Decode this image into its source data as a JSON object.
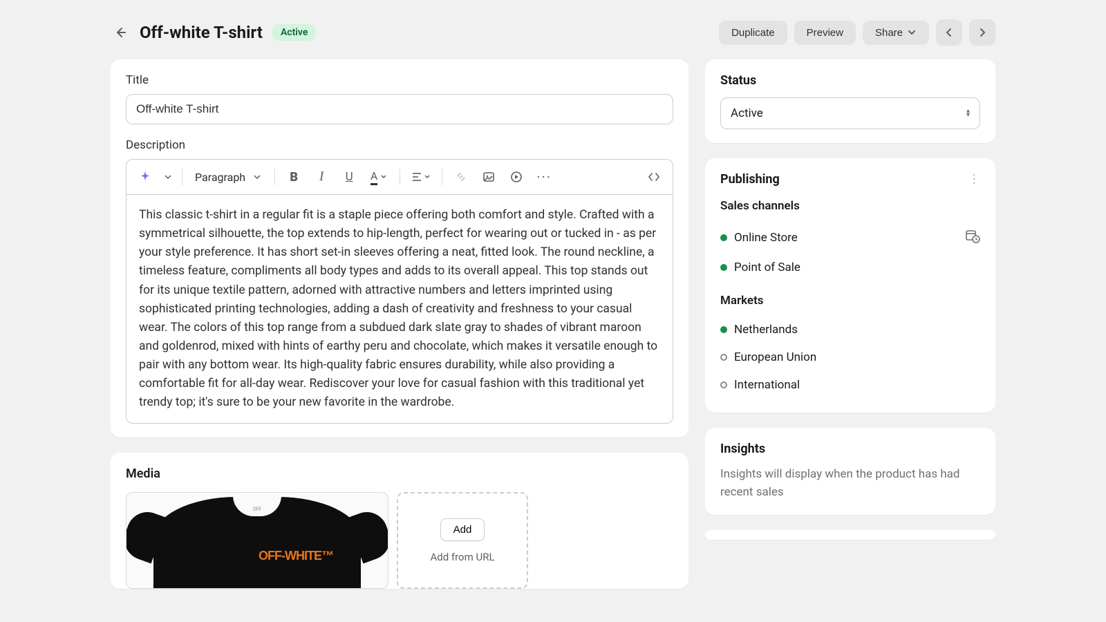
{
  "header": {
    "title": "Off-white T-shirt",
    "badge": "Active",
    "duplicate": "Duplicate",
    "preview": "Preview",
    "share": "Share"
  },
  "titleCard": {
    "label": "Title",
    "value": "Off-white T-shirt"
  },
  "descriptionCard": {
    "label": "Description",
    "paragraph": "Paragraph",
    "body": "This classic t-shirt in a regular fit is a staple piece offering both comfort and style. Crafted with a symmetrical silhouette, the top extends to hip-length, perfect for wearing out or tucked in - as per your style preference. It has short set-in sleeves offering a neat, fitted look. The round neckline, a timeless feature, compliments all body types and adds to its overall appeal. This top stands out for its unique textile pattern, adorned with attractive numbers and letters imprinted using sophisticated printing technologies, adding a dash of creativity and freshness to your casual wear. The colors of this top range from a subdued dark slate gray to shades of vibrant maroon and goldenrod, mixed with hints of earthy peru and chocolate, which makes it versatile enough to pair with any bottom wear. Its high-quality fabric ensures durability, while also providing a comfortable fit for all-day wear. Rediscover your love for casual fashion with this traditional yet trendy top; it's sure to be your new favorite in the wardrobe."
  },
  "mediaCard": {
    "label": "Media",
    "logoText": "OFF-WHITE™",
    "add": "Add",
    "addFromUrl": "Add from URL"
  },
  "status": {
    "label": "Status",
    "value": "Active"
  },
  "publishing": {
    "label": "Publishing",
    "salesChannelsLabel": "Sales channels",
    "channels": [
      {
        "name": "Online Store",
        "active": true
      },
      {
        "name": "Point of Sale",
        "active": true
      }
    ],
    "marketsLabel": "Markets",
    "markets": [
      {
        "name": "Netherlands",
        "active": true
      },
      {
        "name": "European Union",
        "active": false
      },
      {
        "name": "International",
        "active": false
      }
    ]
  },
  "insights": {
    "label": "Insights",
    "text": "Insights will display when the product has had recent sales"
  }
}
